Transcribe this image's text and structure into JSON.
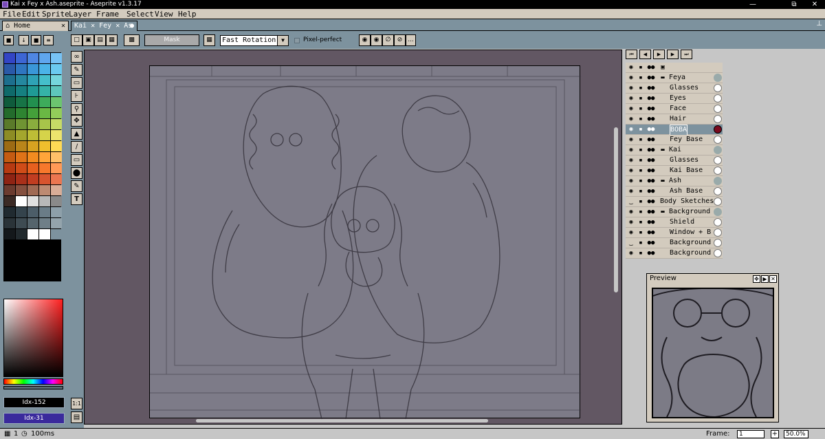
{
  "window": {
    "title": "Kai x Fey x Ash.aseprite - Aseprite v1.3.17",
    "minimize_glyph": "—",
    "maximize_glyph": "⧉",
    "close_glyph": "✕"
  },
  "menu": [
    "File",
    "Edit",
    "Sprite",
    "Layer",
    "Frame",
    "Select",
    "View",
    "Help"
  ],
  "tabs": {
    "home": "Home",
    "home_close": "✕",
    "file": "Kai ✕ Fey ✕ As",
    "file_dot": "●",
    "pin": "⊥"
  },
  "toolbar": {
    "mask_label": "Mask",
    "rotation_value": "Fast Rotation",
    "pixel_perfect_label": "Pixel-perfect",
    "more_label": "..."
  },
  "palette": [
    "#3345c5",
    "#3d66d4",
    "#4f86e2",
    "#5fa6ee",
    "#77c3f5",
    "#2a59a8",
    "#2f76c0",
    "#3a97d8",
    "#4bb3e8",
    "#6bcaf0",
    "#1d6f8e",
    "#25889f",
    "#2fa2b6",
    "#45bfcb",
    "#76d6dc",
    "#0f6a6a",
    "#168080",
    "#1f9a95",
    "#35b3a8",
    "#5ec6bc",
    "#0f5b3c",
    "#177446",
    "#22904f",
    "#3eab5b",
    "#6cc56f",
    "#236b2c",
    "#2e8431",
    "#44a03a",
    "#6ab844",
    "#93cd5a",
    "#5a7a2a",
    "#6f9433",
    "#8aad3e",
    "#a7c54a",
    "#c6db66",
    "#8d8c24",
    "#a4a62d",
    "#bdbd36",
    "#d6d34a",
    "#ece46d",
    "#9c6b14",
    "#b9851a",
    "#d7a221",
    "#f0bf2d",
    "#ffda55",
    "#c45b12",
    "#df7318",
    "#f28b20",
    "#ffa53a",
    "#ffc069",
    "#b73a12",
    "#d04c18",
    "#e7601f",
    "#f7782c",
    "#ff9a57",
    "#8e2414",
    "#a9301a",
    "#c13d21",
    "#d8542f",
    "#eb7650",
    "#6b3b2f",
    "#85503f",
    "#a06a54",
    "#bd8a72",
    "#d9ad97",
    "#3b2a25",
    "#ffffff",
    "#e0e0e0",
    "#b8b8b8",
    "#8a8a8a",
    "#202a30",
    "#34434c",
    "#4c5d68",
    "#6a7c87",
    "#8ea0aa",
    "#2a3338",
    "#3e4b52",
    "#55646c",
    "#6f7f88",
    "#94a4ac",
    "#14181b",
    "#222a2e",
    "#ffffff",
    "#ffffff",
    "#7d929e"
  ],
  "color_indices": {
    "fg": "Idx-152",
    "bg": "Idx-31"
  },
  "layers": [
    {
      "name": "",
      "indent": 0,
      "group": false,
      "header": true
    },
    {
      "name": "Feya",
      "indent": 0,
      "group": true
    },
    {
      "name": "Glasses",
      "indent": 1,
      "group": false
    },
    {
      "name": "Eyes",
      "indent": 1,
      "group": false
    },
    {
      "name": "Face",
      "indent": 1,
      "group": false
    },
    {
      "name": "Hair",
      "indent": 1,
      "group": false
    },
    {
      "name": "BOBA",
      "indent": 1,
      "group": false,
      "selected": true
    },
    {
      "name": "Fey Base",
      "indent": 1,
      "group": false
    },
    {
      "name": "Kai",
      "indent": 0,
      "group": true
    },
    {
      "name": "Glasses",
      "indent": 1,
      "group": false
    },
    {
      "name": "Kai Base",
      "indent": 1,
      "group": false
    },
    {
      "name": "Ash",
      "indent": 0,
      "group": true
    },
    {
      "name": "Ash Base",
      "indent": 1,
      "group": false
    },
    {
      "name": "Body Sketches",
      "indent": 0,
      "group": false,
      "hidden": true
    },
    {
      "name": "Background",
      "indent": 0,
      "group": true
    },
    {
      "name": "Shield",
      "indent": 1,
      "group": false
    },
    {
      "name": "Window + B",
      "indent": 1,
      "group": false
    },
    {
      "name": "Background",
      "indent": 1,
      "group": false,
      "hidden": true
    },
    {
      "name": "Background",
      "indent": 1,
      "group": false
    }
  ],
  "timeline": {
    "frame_header": "1",
    "eye_glyph": "◉",
    "hidden_glyph": "‿",
    "lock_glyph": "▪",
    "link_glyph": "●●",
    "folder_glyph": "▬"
  },
  "preview": {
    "title": "Preview"
  },
  "status": {
    "frame_label": "Frame:",
    "frame_value": "1",
    "zoom_value": "50.0%",
    "frame_count": "1",
    "duration": "100ms"
  }
}
